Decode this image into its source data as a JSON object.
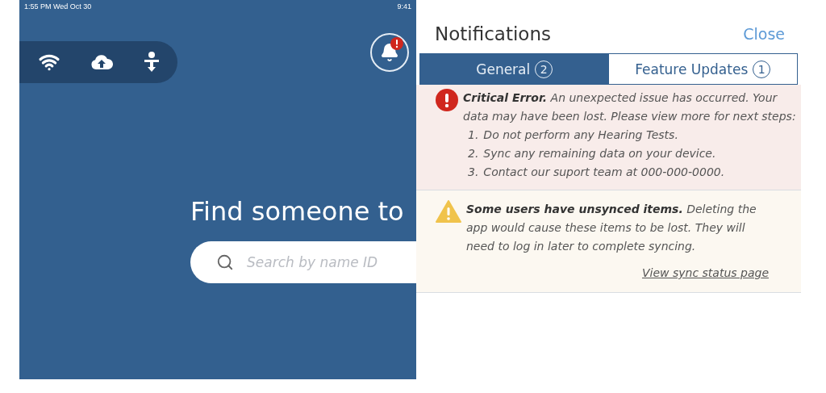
{
  "status_bar": {
    "time_date": "1:55 PM   Wed Oct 30",
    "clock": "9:41"
  },
  "home": {
    "heading": "Find someone to",
    "search": {
      "placeholder": "Search by name ID"
    },
    "notification_badge": true
  },
  "notifications": {
    "title": "Notifications",
    "close": "Close",
    "tabs": [
      {
        "label": "General",
        "count": "2",
        "selected": true
      },
      {
        "label": "Feature Updates",
        "count": "1",
        "selected": false
      }
    ],
    "alerts": [
      {
        "kind": "error",
        "text": "**Critical Error.** An unexpected issue has occurred. Your data may have been lost. Please view more for next steps:",
        "steps": [
          {
            "number": "1.",
            "text": "Do not perform any Hearing Tests."
          },
          {
            "number": "2.",
            "text": "Sync any remaining data on your device."
          },
          {
            "number": "3.",
            "text": "Contact our suport team at 000-000-0000."
          }
        ]
      },
      {
        "kind": "warning",
        "text": "**Some users have unsynced items.** Deleting the app would cause these items to be lost. They will need to log in later to complete syncing.",
        "link": "View sync status page"
      }
    ]
  }
}
